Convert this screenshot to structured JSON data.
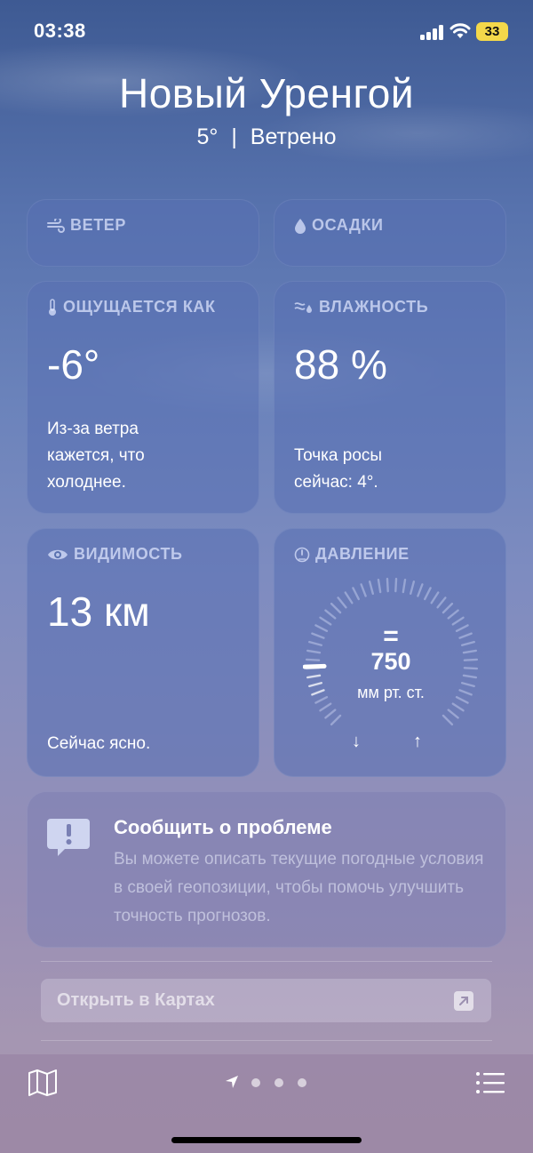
{
  "status_bar": {
    "time": "03:38",
    "battery": "33"
  },
  "header": {
    "city": "Новый Уренгой",
    "temperature": "5°",
    "separator": "|",
    "condition": "Ветрено"
  },
  "cards": {
    "wind": {
      "title": "ВЕТЕР",
      "icon": "wind-icon"
    },
    "precipitation": {
      "title": "ОСАДКИ",
      "icon": "drop-icon"
    },
    "feels_like": {
      "title": "ОЩУЩАЕТСЯ КАК",
      "icon": "thermometer-icon",
      "value": "-6°",
      "description": "Из-за ветра кажется, что холоднее."
    },
    "humidity": {
      "title": "ВЛАЖНОСТЬ",
      "icon": "humidity-icon",
      "value": "88 %",
      "description": "Точка росы сейчас: 4°."
    },
    "visibility": {
      "title": "ВИДИМОСТЬ",
      "icon": "eye-icon",
      "value": "13 км",
      "description": "Сейчас ясно."
    },
    "pressure": {
      "title": "ДАВЛЕНИЕ",
      "icon": "gauge-icon",
      "trend_symbol": "=",
      "value": "750",
      "unit": "мм рт. ст.",
      "low_symbol": "↓",
      "high_symbol": "↑",
      "needle_fraction": 0.16
    }
  },
  "report": {
    "title": "Сообщить о проблеме",
    "text": "Вы можете описать текущие погодные условия в своей геопозиции, чтобы помочь улучшить точность прогнозов.",
    "icon": "exclamation-bubble-icon"
  },
  "maps": {
    "label": "Открыть в Картах",
    "icon": "arrow-up-right-icon"
  },
  "bottom_bar": {
    "left_icon": "map-icon",
    "right_icon": "list-icon",
    "page_dots": 3,
    "current": "location-arrow-icon"
  },
  "colors": {
    "card_bg": "#5870b2",
    "battery": "#f4d84a",
    "muted_label": "#e1e8ff"
  }
}
